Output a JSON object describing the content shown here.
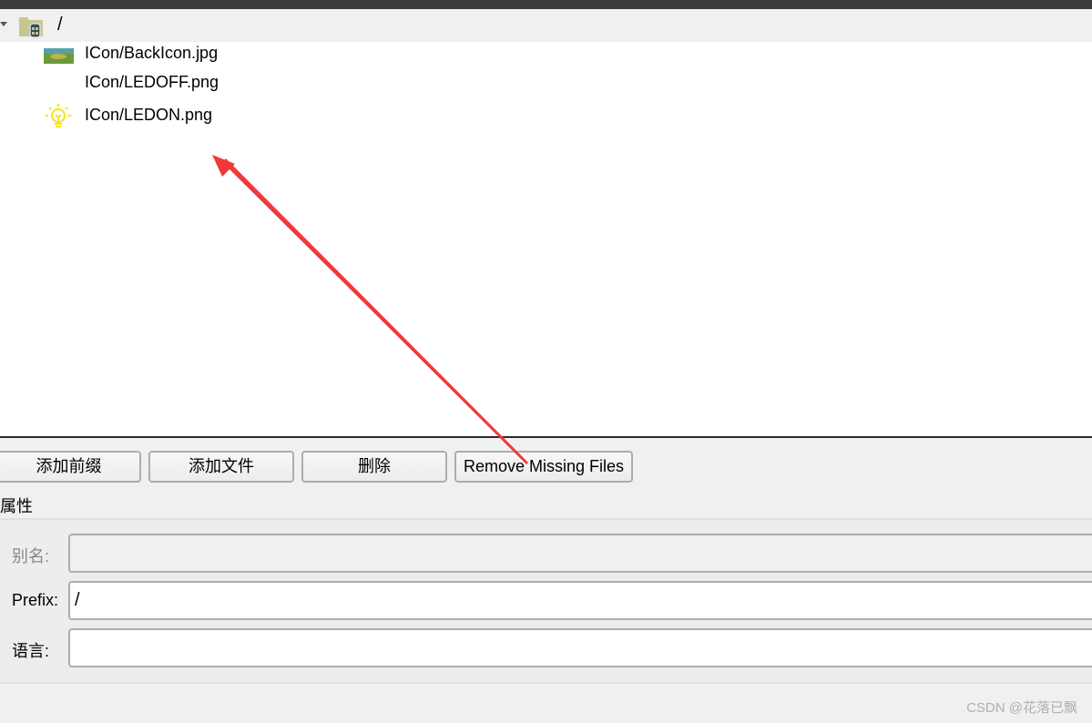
{
  "tree": {
    "root": {
      "label": "/",
      "icon": "resource-folder-icon"
    },
    "items": [
      {
        "label": "ICon/BackIcon.jpg",
        "icon": "landscape-image-icon"
      },
      {
        "label": "ICon/LEDOFF.png",
        "icon": "blank-image-icon"
      },
      {
        "label": "ICon/LEDON.png",
        "icon": "lightbulb-icon"
      }
    ]
  },
  "buttons": {
    "add_prefix": "添加前缀",
    "add_files": "添加文件",
    "remove": "删除",
    "remove_missing": "Remove Missing Files"
  },
  "properties": {
    "title": "属性",
    "alias_label": "别名:",
    "alias_value": "",
    "prefix_label": "Prefix:",
    "prefix_value": "/",
    "language_label": "语言:",
    "language_value": ""
  },
  "annotation": {
    "arrow_color": "#f03a3a"
  },
  "watermark": "CSDN @花落已飘"
}
